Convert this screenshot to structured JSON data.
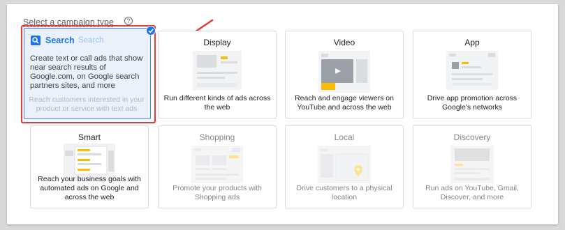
{
  "section": {
    "title": "Select a campaign type",
    "help_icon": "question-circle-icon"
  },
  "search_card": {
    "title": "Search",
    "ghost_title": "Search",
    "tooltip": "Create text or call ads that show near search results of Google.com, on Google search partners sites, and more",
    "description": "Reach customers interested in your product or service with text ads",
    "selected": true
  },
  "cards": {
    "display": {
      "name": "Display",
      "description": "Run different kinds of ads across the web"
    },
    "video": {
      "name": "Video",
      "description": "Reach and engage viewers on YouTube and across the web"
    },
    "app": {
      "name": "App",
      "description": "Drive app promotion across Google's networks"
    },
    "smart": {
      "name": "Smart",
      "description": "Reach your business goals with automated ads on Google and across the web"
    },
    "shopping": {
      "name": "Shopping",
      "description": "Promote your products with Shopping ads"
    },
    "local": {
      "name": "Local",
      "description": "Drive customers to a physical location"
    },
    "discovery": {
      "name": "Discovery",
      "description": "Run ads on YouTube, Gmail, Discover, and more"
    }
  },
  "colors": {
    "accent": "#1a73e8",
    "highlight": "#e03a3a",
    "ad_yellow": "#fbbc04"
  }
}
